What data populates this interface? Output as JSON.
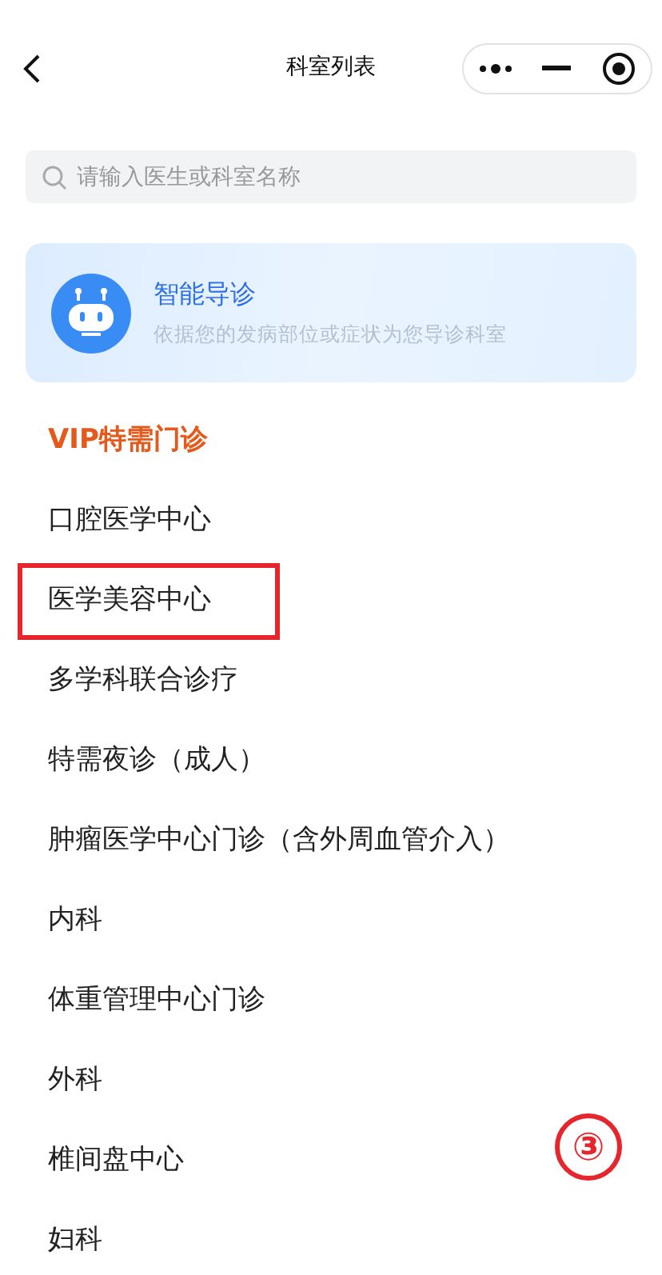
{
  "header": {
    "title": "科室列表"
  },
  "search": {
    "placeholder": "请输入医生或科室名称"
  },
  "guide_card": {
    "title": "智能导诊",
    "subtitle": "依据您的发病部位或症状为您导诊科室"
  },
  "departments": [
    {
      "label": "VIP特需门诊",
      "selected": true,
      "annotated": false
    },
    {
      "label": "口腔医学中心",
      "selected": false,
      "annotated": false
    },
    {
      "label": "医学美容中心",
      "selected": false,
      "annotated": true
    },
    {
      "label": "多学科联合诊疗",
      "selected": false,
      "annotated": false
    },
    {
      "label": "特需夜诊（成人）",
      "selected": false,
      "annotated": false
    },
    {
      "label": "肿瘤医学中心门诊（含外周血管介入）",
      "selected": false,
      "annotated": false
    },
    {
      "label": "内科",
      "selected": false,
      "annotated": false
    },
    {
      "label": "体重管理中心门诊",
      "selected": false,
      "annotated": false
    },
    {
      "label": "外科",
      "selected": false,
      "annotated": false
    },
    {
      "label": "椎间盘中心",
      "selected": false,
      "annotated": false
    },
    {
      "label": "妇科",
      "selected": false,
      "annotated": false
    }
  ],
  "annotation_mark": "③"
}
